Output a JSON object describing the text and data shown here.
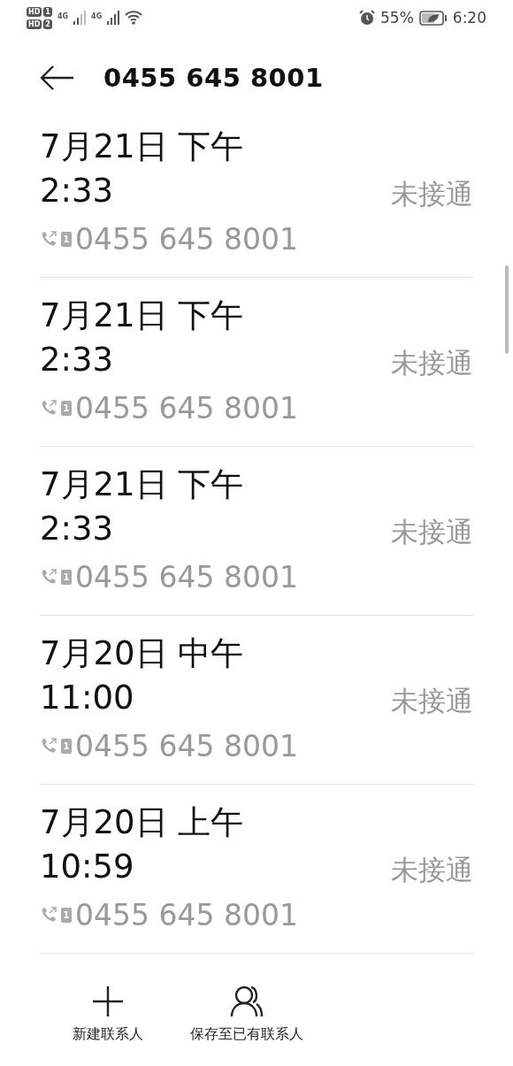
{
  "status_bar": {
    "sims": [
      {
        "badge": "HD",
        "slot": "1"
      },
      {
        "badge": "HD",
        "slot": "2"
      }
    ],
    "networks": [
      "4G",
      "4G"
    ],
    "battery_text": "55%",
    "time": "6:20"
  },
  "header": {
    "title": "0455 645 8001"
  },
  "calls": [
    {
      "date": "7月21日 下午",
      "time": "2:33",
      "sim": "1",
      "number": "0455 645 8001",
      "status": "未接通"
    },
    {
      "date": "7月21日 下午",
      "time": "2:33",
      "sim": "1",
      "number": "0455 645 8001",
      "status": "未接通"
    },
    {
      "date": "7月21日 下午",
      "time": "2:33",
      "sim": "1",
      "number": "0455 645 8001",
      "status": "未接通"
    },
    {
      "date": "7月20日 中午",
      "time": "11:00",
      "sim": "1",
      "number": "0455 645 8001",
      "status": "未接通"
    },
    {
      "date": "7月20日 上午",
      "time": "10:59",
      "sim": "1",
      "number": "0455 645 8001",
      "status": "未接通"
    }
  ],
  "actions": [
    {
      "kind": "new",
      "label": "新建联系人"
    },
    {
      "kind": "existing",
      "label": "保存至已有联系人"
    }
  ]
}
